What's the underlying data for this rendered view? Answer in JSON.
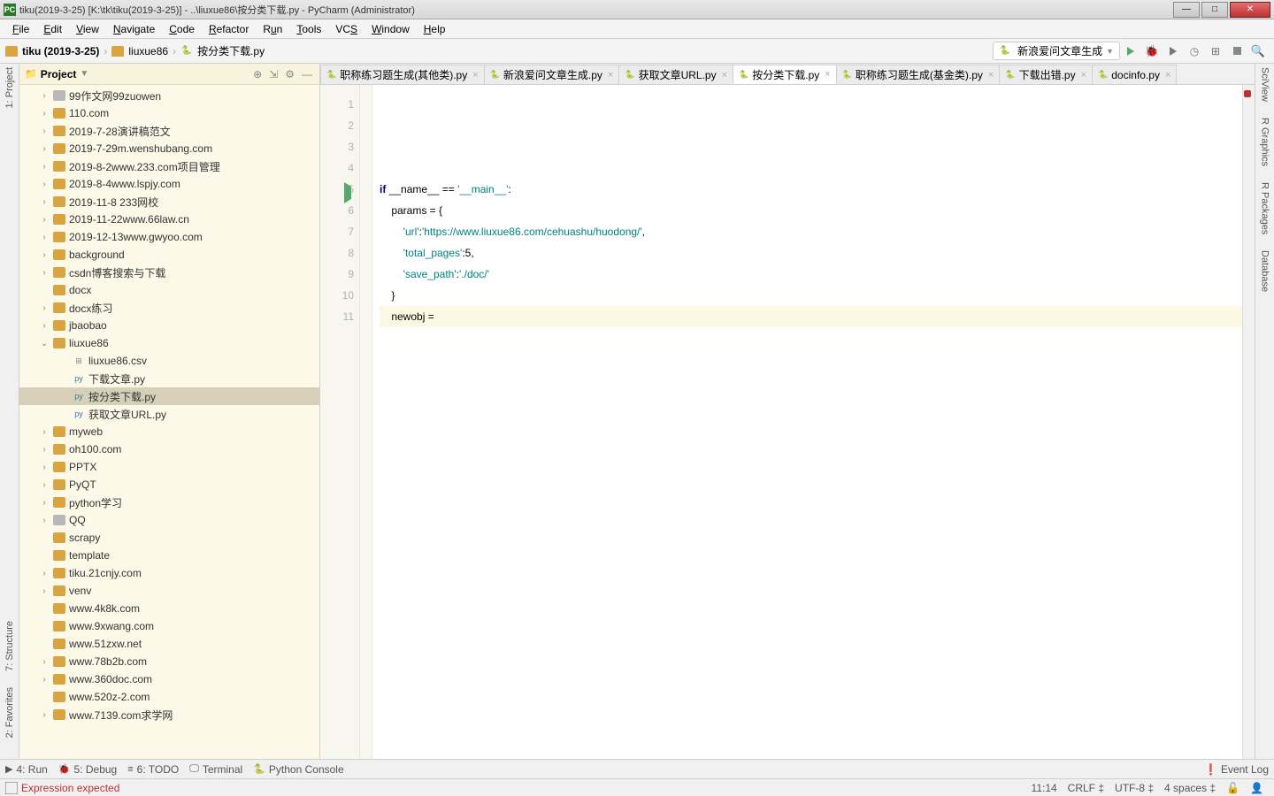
{
  "window": {
    "title": "tiku(2019-3-25) [K:\\tk\\tiku(2019-3-25)] - ..\\liuxue86\\按分类下载.py - PyCharm (Administrator)"
  },
  "menu": [
    "File",
    "Edit",
    "View",
    "Navigate",
    "Code",
    "Refactor",
    "Run",
    "Tools",
    "VCS",
    "Window",
    "Help"
  ],
  "breadcrumb": {
    "root": "tiku (2019-3-25)",
    "folder": "liuxue86",
    "file": "按分类下载.py"
  },
  "run_config": "新浪爱问文章生成",
  "project": {
    "title": "Project",
    "items": [
      {
        "type": "folder",
        "label": "99作文网99zuowen",
        "indent": 1,
        "chev": ">",
        "gray": true
      },
      {
        "type": "folder",
        "label": "110.com",
        "indent": 1,
        "chev": ">"
      },
      {
        "type": "folder",
        "label": "2019-7-28演讲稿范文",
        "indent": 1,
        "chev": ">"
      },
      {
        "type": "folder",
        "label": "2019-7-29m.wenshubang.com",
        "indent": 1,
        "chev": ">"
      },
      {
        "type": "folder",
        "label": "2019-8-2www.233.com项目管理",
        "indent": 1,
        "chev": ">"
      },
      {
        "type": "folder",
        "label": "2019-8-4www.lspjy.com",
        "indent": 1,
        "chev": ">"
      },
      {
        "type": "folder",
        "label": "2019-11-8 233网校",
        "indent": 1,
        "chev": ">"
      },
      {
        "type": "folder",
        "label": "2019-11-22www.66law.cn",
        "indent": 1,
        "chev": ">"
      },
      {
        "type": "folder",
        "label": "2019-12-13www.gwyoo.com",
        "indent": 1,
        "chev": ">"
      },
      {
        "type": "folder",
        "label": "background",
        "indent": 1,
        "chev": ">"
      },
      {
        "type": "folder",
        "label": "csdn博客搜索与下载",
        "indent": 1,
        "chev": ">"
      },
      {
        "type": "folder",
        "label": "docx",
        "indent": 1,
        "chev": ""
      },
      {
        "type": "folder",
        "label": "docx练习",
        "indent": 1,
        "chev": ">"
      },
      {
        "type": "folder",
        "label": "jbaobao",
        "indent": 1,
        "chev": ">"
      },
      {
        "type": "folder",
        "label": "liuxue86",
        "indent": 1,
        "chev": "v"
      },
      {
        "type": "csv",
        "label": "liuxue86.csv",
        "indent": 2,
        "chev": ""
      },
      {
        "type": "py",
        "label": "下载文章.py",
        "indent": 2,
        "chev": ""
      },
      {
        "type": "py",
        "label": "按分类下载.py",
        "indent": 2,
        "chev": "",
        "selected": true
      },
      {
        "type": "py",
        "label": "获取文章URL.py",
        "indent": 2,
        "chev": ""
      },
      {
        "type": "folder",
        "label": "myweb",
        "indent": 1,
        "chev": ">"
      },
      {
        "type": "folder",
        "label": "oh100.com",
        "indent": 1,
        "chev": ">"
      },
      {
        "type": "folder",
        "label": "PPTX",
        "indent": 1,
        "chev": ">"
      },
      {
        "type": "folder",
        "label": "PyQT",
        "indent": 1,
        "chev": ">"
      },
      {
        "type": "folder",
        "label": "python学习",
        "indent": 1,
        "chev": ">"
      },
      {
        "type": "folder",
        "label": "QQ",
        "indent": 1,
        "chev": ">",
        "gray": true
      },
      {
        "type": "folder",
        "label": "scrapy",
        "indent": 1,
        "chev": ""
      },
      {
        "type": "folder",
        "label": "template",
        "indent": 1,
        "chev": ""
      },
      {
        "type": "folder",
        "label": "tiku.21cnjy.com",
        "indent": 1,
        "chev": ">"
      },
      {
        "type": "folder",
        "label": "venv",
        "indent": 1,
        "chev": ">"
      },
      {
        "type": "folder",
        "label": "www.4k8k.com",
        "indent": 1,
        "chev": ""
      },
      {
        "type": "folder",
        "label": "www.9xwang.com",
        "indent": 1,
        "chev": ""
      },
      {
        "type": "folder",
        "label": "www.51zxw.net",
        "indent": 1,
        "chev": ""
      },
      {
        "type": "folder",
        "label": "www.78b2b.com",
        "indent": 1,
        "chev": ">"
      },
      {
        "type": "folder",
        "label": "www.360doc.com",
        "indent": 1,
        "chev": ">"
      },
      {
        "type": "folder",
        "label": "www.520z-2.com",
        "indent": 1,
        "chev": ""
      },
      {
        "type": "folder",
        "label": "www.7139.com求学网",
        "indent": 1,
        "chev": ">"
      }
    ]
  },
  "tabs": [
    {
      "label": "职称练习题生成(其他类).py"
    },
    {
      "label": "新浪爱问文章生成.py"
    },
    {
      "label": "获取文章URL.py"
    },
    {
      "label": "按分类下载.py",
      "active": true
    },
    {
      "label": "职称练习题生成(基金类).py"
    },
    {
      "label": "下载出错.py"
    },
    {
      "label": "docinfo.py"
    }
  ],
  "code": {
    "lines": [
      "1",
      "2",
      "3",
      "4",
      "5",
      "6",
      "7",
      "8",
      "9",
      "10",
      "11"
    ],
    "l5a": "if",
    "l5b": " __name__ == ",
    "l5c": "'__main__'",
    "l5d": ":",
    "l6": "    params = {",
    "l7a": "        ",
    "l7b": "'url'",
    "l7c": ":",
    "l7d": "'https://www.liuxue86.com/cehuashu/huodong/'",
    "l7e": ",",
    "l8a": "        ",
    "l8b": "'total_pages'",
    "l8c": ":5,",
    "l9a": "        ",
    "l9b": "'save_path'",
    "l9c": ":",
    "l9d": "'./doc/'",
    "l10": "    }",
    "l11": "    newobj = "
  },
  "left_tabs": [
    "1: Project"
  ],
  "left_tabs_bottom": [
    "2: Favorites",
    "7: Structure"
  ],
  "right_tabs": [
    "SciView",
    "R Graphics",
    "R Packages",
    "Database"
  ],
  "bottom_tools": {
    "run": "4: Run",
    "debug": "5: Debug",
    "todo": "6: TODO",
    "terminal": "Terminal",
    "pyconsole": "Python Console",
    "eventlog": "Event Log"
  },
  "status": {
    "msg": "Expression expected",
    "pos": "11:14",
    "crlf": "CRLF",
    "enc": "UTF-8",
    "indent": "4 spaces"
  }
}
